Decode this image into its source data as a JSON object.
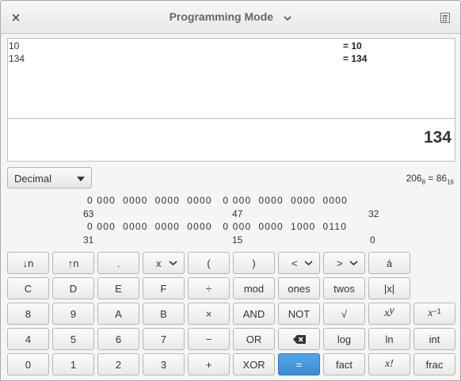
{
  "window": {
    "title": "Programming Mode",
    "close_glyph": "×"
  },
  "history": [
    {
      "expr": "10",
      "result": "= 10"
    },
    {
      "expr": "134",
      "result": "= 134"
    }
  ],
  "display": {
    "value": "134"
  },
  "base_select": {
    "selected": "Decimal"
  },
  "conversion": {
    "octal": "206",
    "octal_sub": "8",
    "eq": " = ",
    "hex": "86",
    "hex_sub": "16"
  },
  "bits": {
    "row1": "0 000  0000  0000  0000   0 000  0000  0000  0000",
    "row1_labels": [
      "63",
      "47",
      "32"
    ],
    "row2": "0 000  0000  0000  0000   0 000  0000  1000  0110",
    "row2_labels": [
      "31",
      "15",
      "0"
    ]
  },
  "buttons": {
    "shift_left": "↓n",
    "shift_right": "↑n",
    "point": ".",
    "x_var": "x",
    "open_paren": "(",
    "close_paren": ")",
    "lt": "<",
    "gt": ">",
    "char": "á",
    "c": "C",
    "d": "D",
    "e": "E",
    "f": "F",
    "divide": "÷",
    "mod": "mod",
    "ones": "ones",
    "twos": "twos",
    "abs": "|x|",
    "n8": "8",
    "n9": "9",
    "a": "A",
    "b": "B",
    "multiply": "×",
    "and": "AND",
    "not": "NOT",
    "sqrt": "√",
    "power_base": "x",
    "power_exp": "y",
    "inverse_base": "x",
    "inverse_exp": "−1",
    "n4": "4",
    "n5": "5",
    "n6": "6",
    "n7": "7",
    "minus": "−",
    "or": "OR",
    "log": "log",
    "ln": "ln",
    "int": "int",
    "n0": "0",
    "n1": "1",
    "n2": "2",
    "n3": "3",
    "plus": "+",
    "xor": "XOR",
    "equals": "=",
    "fact": "fact",
    "factorial": "x!",
    "frac": "frac"
  },
  "colors": {
    "accent": "#3b8ad6"
  }
}
